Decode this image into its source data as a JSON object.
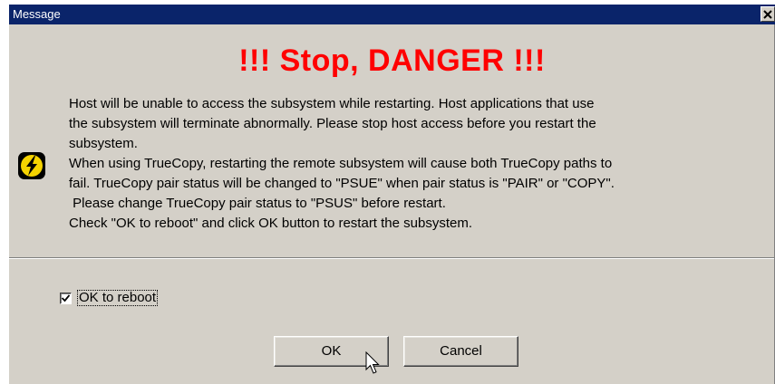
{
  "window": {
    "title": "Message",
    "close_glyph": "✕"
  },
  "dialog": {
    "heading": "!!! Stop, DANGER !!!",
    "heading_color": "#ff0000",
    "icon": "warning-lightning-icon",
    "message_lines": [
      "Host will be unable to access the subsystem while restarting. Host applications that use",
      "the subsystem will terminate abnormally. Please stop host access before you restart the",
      "subsystem.",
      "When using TrueCopy, restarting the remote subsystem will cause both TrueCopy paths to",
      "fail. TrueCopy pair status will be changed to \"PSUE\" when pair status is \"PAIR\" or \"COPY\".",
      " Please change TrueCopy pair status to \"PSUS\" before restart.",
      "Check \"OK to reboot\" and click OK button to restart the subsystem."
    ]
  },
  "confirm": {
    "label": "OK to reboot",
    "checked": true
  },
  "buttons": {
    "ok_label": "OK",
    "cancel_label": "Cancel"
  },
  "colors": {
    "titlebar": "#0a246a",
    "dialog_bg": "#d4d0c8"
  }
}
